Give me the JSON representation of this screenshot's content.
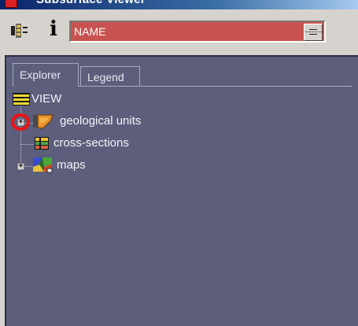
{
  "window": {
    "title": "Subsurface Viewer"
  },
  "toolbar": {
    "tree_icon": "tree-view-icon",
    "info_icon": "info-icon",
    "info_glyph": "i",
    "attribute_combo": {
      "value": "NAME",
      "background": "#c8524f"
    }
  },
  "tabs": [
    {
      "label": "Explorer",
      "selected": true
    },
    {
      "label": "Legend",
      "selected": false
    }
  ],
  "tree": {
    "root": {
      "label": "VIEW",
      "icon": "view-icon"
    },
    "items": [
      {
        "label": "geological units",
        "icon": "geological-units-icon",
        "expander": "+",
        "highlighted": true
      },
      {
        "label": "cross-sections",
        "icon": "cross-sections-icon"
      },
      {
        "label": "maps",
        "icon": "maps-icon",
        "expander": "+"
      }
    ]
  },
  "colors": {
    "panel": "#5c5e7c",
    "highlight": "#ee1111",
    "chrome": "#d6d3ce"
  }
}
